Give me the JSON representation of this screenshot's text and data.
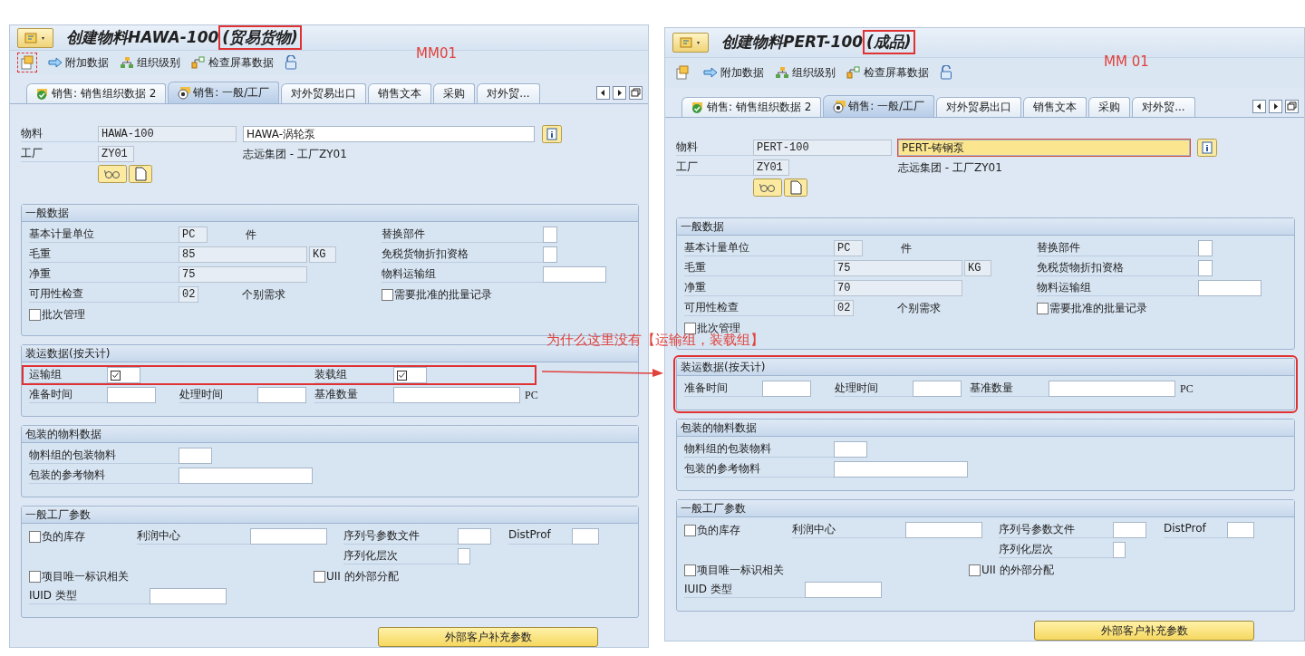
{
  "panels": [
    {
      "title": "创建物料HAWA-100 ",
      "title_tag": "(贸易货物)",
      "title_tag_highlighted": true,
      "note": "MM01",
      "first_tool_highlighted": true,
      "toolbar": [
        "附加数据",
        "组织级别",
        "检查屏幕数据"
      ],
      "tabs": [
        {
          "label": "销售: 销售组织数据 2",
          "selected": false,
          "done": true
        },
        {
          "label": "销售: 一般/工厂",
          "selected": true,
          "done": false
        },
        {
          "label": "对外贸易出口",
          "selected": false,
          "done": false
        },
        {
          "label": "销售文本",
          "selected": false,
          "done": false
        },
        {
          "label": "采购",
          "selected": false,
          "done": false
        },
        {
          "label": "对外贸...",
          "selected": false,
          "done": false
        }
      ],
      "material": {
        "label": "物料",
        "value": "HAWA-100",
        "description": "HAWA-涡轮泵",
        "focused": false
      },
      "plant": {
        "label": "工厂",
        "value": "ZY01",
        "name": "志远集团 - 工厂ZY01"
      },
      "general": {
        "title": "一般数据",
        "base_unit": {
          "label": "基本计量单位",
          "value": "PC",
          "text": "件"
        },
        "gross_weight": {
          "label": "毛重",
          "value": "85",
          "unit": "KG"
        },
        "net_weight": {
          "label": "净重",
          "value": "75"
        },
        "availability": {
          "label": "可用性检查",
          "value": "02",
          "text": "个别需求"
        },
        "batch": {
          "label": "批次管理",
          "checked": false
        },
        "replacement": "替换部件",
        "duty_free": "免税货物折扣资格",
        "transport_group": "物料运输组",
        "approved_batch": {
          "label": "需要批准的批量记录",
          "checked": false
        }
      },
      "shipping": {
        "title": "装运数据(按天计)",
        "highlighted": false,
        "groups": {
          "highlighted": true,
          "transport": {
            "label": "运输组",
            "checked": true
          },
          "loading": {
            "label": "装载组",
            "checked": true
          }
        },
        "setup_time": "准备时间",
        "processing_time": "处理时间",
        "base_qty": {
          "label": "基准数量",
          "unit": "PC"
        }
      },
      "packaging": {
        "title": "包装的物料数据",
        "group": "物料组的包装物料",
        "reference": "包装的参考物料"
      },
      "plant_params": {
        "title": "一般工厂参数",
        "negative_stock": {
          "label": "负的库存",
          "checked": false
        },
        "profit_center": "利润中心",
        "serial_profile": "序列号参数文件",
        "distprof": "DistProf",
        "serial_level": "序列化层次",
        "iuid_relevant": {
          "label": "项目唯一标识相关",
          "checked": false
        },
        "uii_external": {
          "label": "UII 的外部分配",
          "checked": false
        },
        "iuid_type": "IUID 类型"
      },
      "button": "外部客户补充参数"
    },
    {
      "title": "创建物料PERT-100 ",
      "title_tag": "(成品)",
      "title_tag_highlighted": true,
      "note": "MM 01",
      "first_tool_highlighted": false,
      "toolbar": [
        "附加数据",
        "组织级别",
        "检查屏幕数据"
      ],
      "tabs": [
        {
          "label": "销售: 销售组织数据 2",
          "selected": false,
          "done": true
        },
        {
          "label": "销售: 一般/工厂",
          "selected": true,
          "done": false
        },
        {
          "label": "对外贸易出口",
          "selected": false,
          "done": false
        },
        {
          "label": "销售文本",
          "selected": false,
          "done": false
        },
        {
          "label": "采购",
          "selected": false,
          "done": false
        },
        {
          "label": "对外贸...",
          "selected": false,
          "done": false
        }
      ],
      "material": {
        "label": "物料",
        "value": "PERT-100",
        "description": "PERT-铸钢泵",
        "focused": true
      },
      "plant": {
        "label": "工厂",
        "value": "ZY01",
        "name": "志远集团 - 工厂ZY01"
      },
      "general": {
        "title": "一般数据",
        "base_unit": {
          "label": "基本计量单位",
          "value": "PC",
          "text": "件"
        },
        "gross_weight": {
          "label": "毛重",
          "value": "75",
          "unit": "KG"
        },
        "net_weight": {
          "label": "净重",
          "value": "70"
        },
        "availability": {
          "label": "可用性检查",
          "value": "02",
          "text": "个别需求"
        },
        "batch": {
          "label": "批次管理",
          "checked": false
        },
        "replacement": "替换部件",
        "duty_free": "免税货物折扣资格",
        "transport_group": "物料运输组",
        "approved_batch": {
          "label": "需要批准的批量记录",
          "checked": false
        }
      },
      "shipping": {
        "title": "装运数据(按天计)",
        "highlighted": true,
        "setup_time": "准备时间",
        "processing_time": "处理时间",
        "base_qty": {
          "label": "基准数量",
          "unit": "PC"
        }
      },
      "packaging": {
        "title": "包装的物料数据",
        "group": "物料组的包装物料",
        "reference": "包装的参考物料"
      },
      "plant_params": {
        "title": "一般工厂参数",
        "negative_stock": {
          "label": "负的库存",
          "checked": false
        },
        "profit_center": "利润中心",
        "serial_profile": "序列号参数文件",
        "distprof": "DistProf",
        "serial_level": "序列化层次",
        "iuid_relevant": {
          "label": "项目唯一标识相关",
          "checked": false
        },
        "uii_external": {
          "label": "UII 的外部分配",
          "checked": false
        },
        "iuid_type": "IUID 类型"
      },
      "button": "外部客户补充参数"
    }
  ],
  "annotation": {
    "question": "为什么这里没有【运输组，装载组】"
  }
}
